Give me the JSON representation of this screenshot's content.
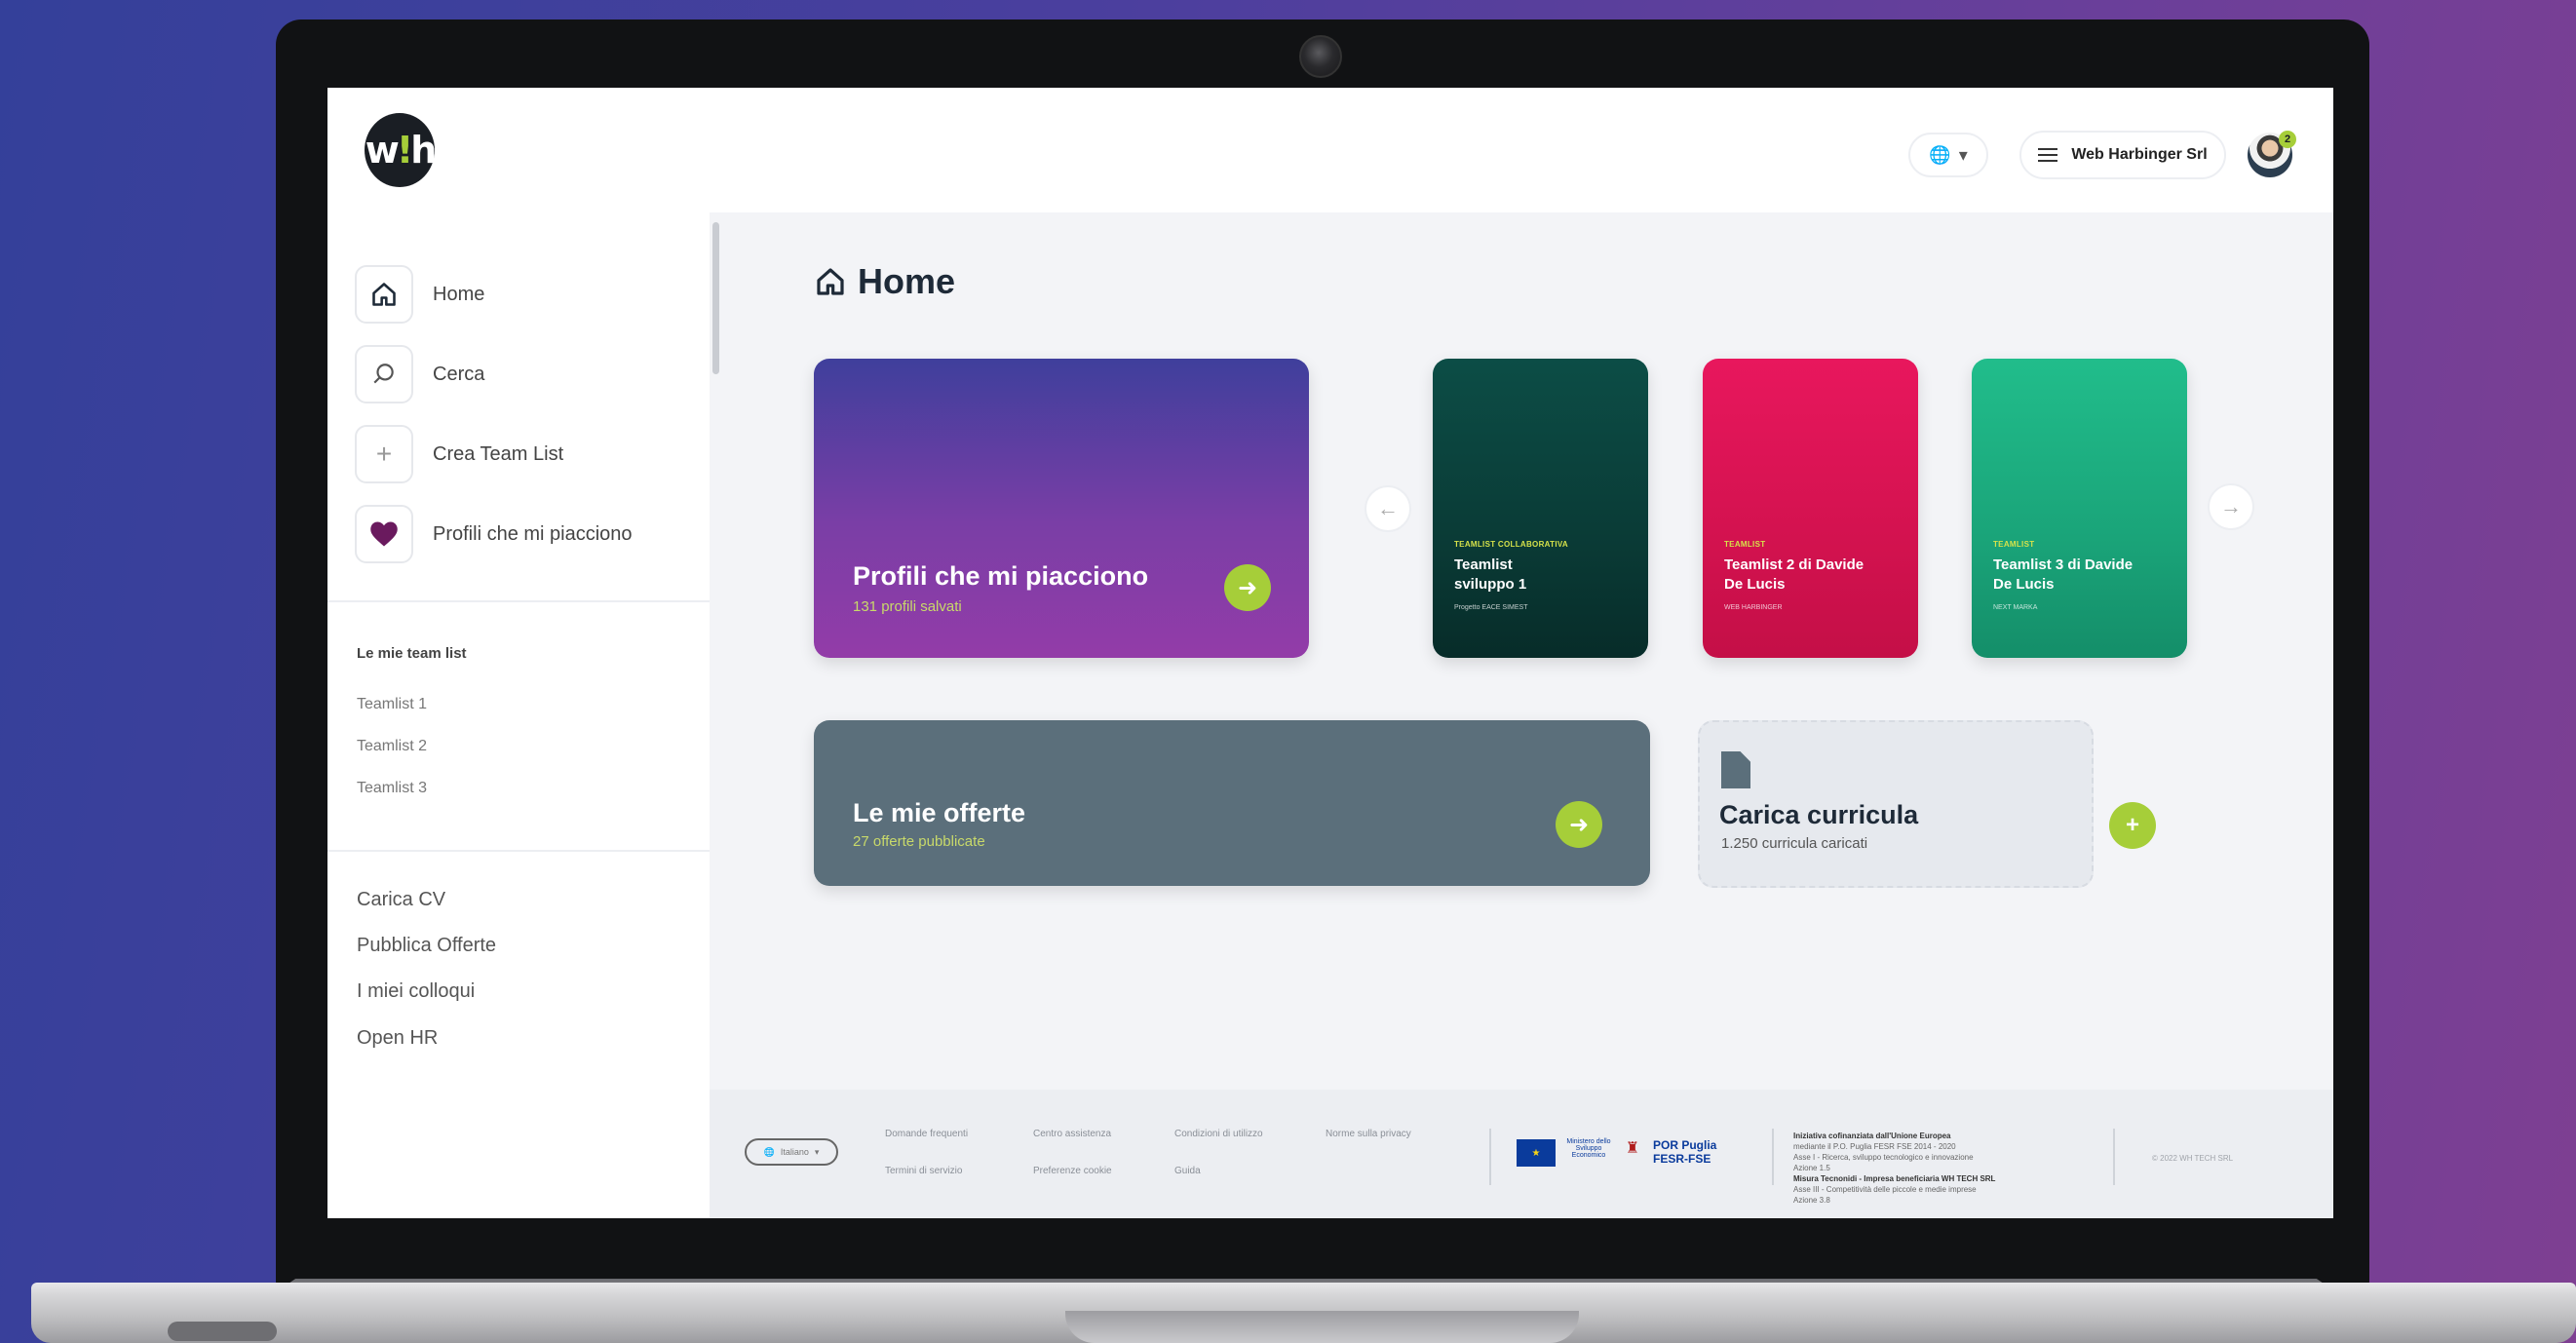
{
  "header": {
    "company_name": "Web Harbinger Srl",
    "avatar_badge": "2",
    "logo_text": "wh"
  },
  "sidebar": {
    "nav": [
      {
        "label": "Home",
        "icon": "home-icon"
      },
      {
        "label": "Cerca",
        "icon": "search-icon"
      },
      {
        "label": "Crea Team List",
        "icon": "plus-icon"
      },
      {
        "label": "Profili che mi piacciono",
        "icon": "heart-icon"
      }
    ],
    "teamlists_heading": "Le mie team list",
    "teamlists": [
      "Teamlist 1",
      "Teamlist 2",
      "Teamlist 3"
    ],
    "links": [
      "Carica CV",
      "Pubblica Offerte",
      "I miei colloqui",
      "Open HR"
    ]
  },
  "main": {
    "title": "Home",
    "favorites_card": {
      "title": "Profili che mi piacciono",
      "subtitle": "131 profili salvati"
    },
    "teamlist_cards": [
      {
        "category": "TEAMLIST COLLABORATIVA",
        "name": "Teamlist sviluppo 1",
        "meta": "Progetto EACE SIMEST",
        "color": "#0a3b36"
      },
      {
        "category": "TEAMLIST",
        "name": "Teamlist 2 di Davide De Lucis",
        "meta": "WEB HARBINGER",
        "color": "#d3124f"
      },
      {
        "category": "TEAMLIST",
        "name": "Teamlist 3 di Davide De Lucis",
        "meta": "NEXT MARKA",
        "color": "#1aa479"
      }
    ],
    "offers_card": {
      "title": "Le mie offerte",
      "subtitle": "27 offerte pubblicate"
    },
    "cv_card": {
      "title": "Carica curricula",
      "subtitle": "1.250 curricula caricati"
    }
  },
  "footer": {
    "language": "Italiano",
    "links_row1": [
      "Domande frequenti",
      "Centro assistenza",
      "Condizioni di utilizzo",
      "Norme sulla privacy"
    ],
    "links_row2": [
      "Termini di servizio",
      "Preferenze cookie",
      "Guida"
    ],
    "funding_title": "Iniziativa cofinanziata dall'Unione Europea",
    "funding_lines": [
      "mediante il P.O. Puglia FESR FSE 2014 - 2020",
      "Asse I - Ricerca, sviluppo tecnologico e innovazione",
      "Azione 1.5",
      "Misura Tecnonidi - Impresa beneficiaria WH TECH SRL",
      "Asse III - Competitività delle piccole e medie imprese",
      "Azione 3.8"
    ],
    "logos": [
      "Unione Europea",
      "Ministero dello Sviluppo Economico",
      "Regione Puglia",
      "POR Puglia FESR-FSE"
    ],
    "copyright": "© 2022 WH TECH SRL"
  },
  "colors": {
    "accent": "#a6ce39",
    "dark": "#1e2a38",
    "offers": "#5b6f7b",
    "favorites_gradient_end": "#933ca8"
  }
}
